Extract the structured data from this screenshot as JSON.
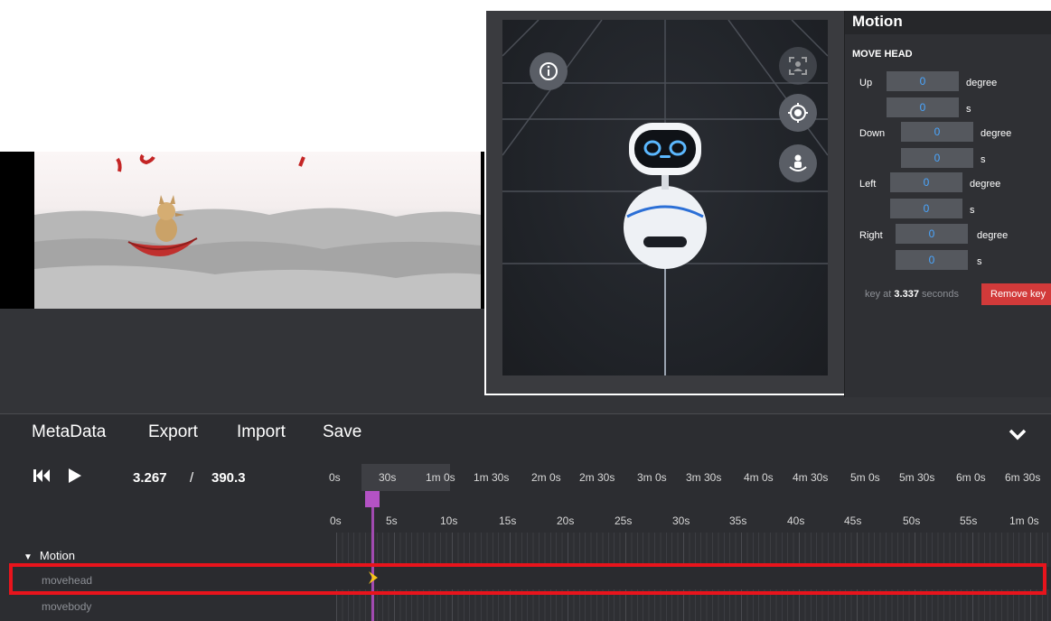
{
  "colors": {
    "accent_red": "#d23a3a",
    "highlight_red": "#e8141c",
    "playhead": "#b352c4",
    "input_value": "#4aa6ff",
    "keyframe": "#f5c518"
  },
  "icons": {
    "info": "info-icon",
    "focus": "focus-frame-icon",
    "target": "crosshair-target-icon",
    "rotate_user": "rotate-user-icon",
    "skip_back": "skip-to-start-icon",
    "play": "play-icon",
    "collapse": "chevron-down-icon",
    "group_toggle": "triangle-down-icon",
    "keyframe": "keyframe-icon"
  },
  "motion_panel": {
    "title": "Motion",
    "section": "MOVE HEAD",
    "rows": [
      {
        "label": "Up",
        "degree": "0",
        "seconds": "0"
      },
      {
        "label": "Down",
        "degree": "0",
        "seconds": "0"
      },
      {
        "label": "Left",
        "degree": "0",
        "seconds": "0"
      },
      {
        "label": "Right",
        "degree": "0",
        "seconds": "0"
      }
    ],
    "degree_unit": "degree",
    "seconds_unit": "s",
    "key_at_prefix": "key at",
    "key_at_value": "3.337",
    "key_at_suffix": "seconds",
    "remove_key_label": "Remove key"
  },
  "menu": {
    "items": [
      "MetaData",
      "Export",
      "Import",
      "Save"
    ]
  },
  "transport": {
    "current_time": "3.267",
    "separator": "/",
    "total_time": "390.3"
  },
  "ruler_overview": [
    "0s",
    "30s",
    "1m 0s",
    "1m 30s",
    "2m 0s",
    "2m 30s",
    "3m 0s",
    "3m 30s",
    "4m 0s",
    "4m 30s",
    "5m 0s",
    "5m 30s",
    "6m 0s",
    "6m 30s"
  ],
  "ruler_detail": [
    "0s",
    "5s",
    "10s",
    "15s",
    "20s",
    "25s",
    "30s",
    "35s",
    "40s",
    "45s",
    "50s",
    "55s",
    "1m 0s"
  ],
  "tracks": {
    "group": "Motion",
    "items": [
      "movehead",
      "movebody"
    ]
  }
}
